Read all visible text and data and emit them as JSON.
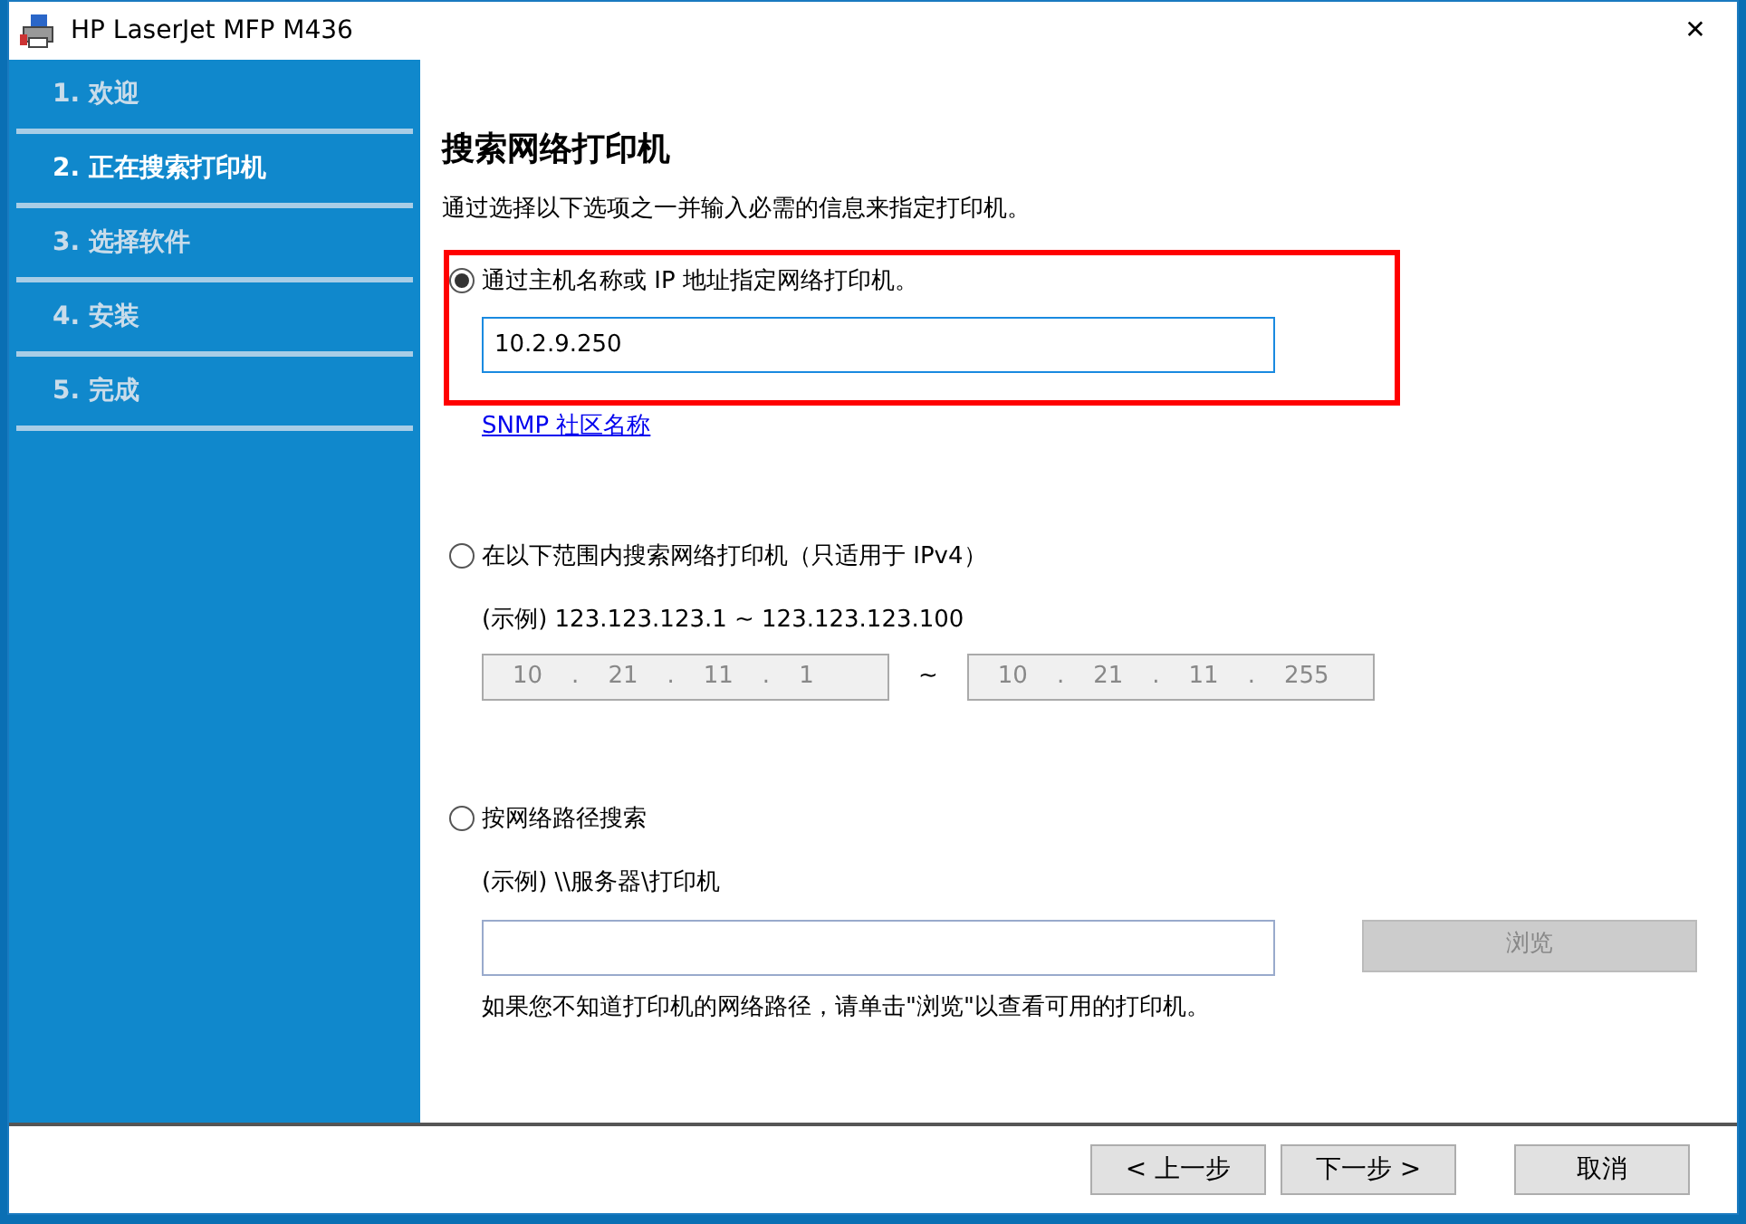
{
  "window": {
    "title": "HP LaserJet MFP M436",
    "close": "✕"
  },
  "sidebar": {
    "items": [
      {
        "label": "1. 欢迎",
        "selected": false
      },
      {
        "label": "2. 正在搜索打印机",
        "selected": true
      },
      {
        "label": "3. 选择软件",
        "selected": false
      },
      {
        "label": "4. 安装",
        "selected": false
      },
      {
        "label": "5. 完成",
        "selected": false
      }
    ]
  },
  "heading": "搜索网络打印机",
  "intro": "通过选择以下选项之一并输入必需的信息来指定打印机。",
  "options": [
    {
      "kind": "host",
      "label": "通过主机名称或 IP 地址指定网络打印机。",
      "selected": true,
      "highlighted": true,
      "value": "10.2.9.250",
      "link": "SNMP 社区名称"
    },
    {
      "kind": "range",
      "label": "在以下范围内搜索网络打印机（只适用于 IPv4）",
      "selected": false,
      "example": "(示例) 123.123.123.1 ~ 123.123.123.100",
      "from": [
        "10",
        "21",
        "11",
        "1"
      ],
      "to": [
        "10",
        "21",
        "11",
        "255"
      ],
      "separator": ".",
      "between": "~"
    },
    {
      "kind": "path",
      "label": "按网络路径搜索",
      "selected": false,
      "example": "(示例) \\\\服务器\\打印机",
      "button": "浏览",
      "button_disabled": true,
      "hint": "如果您不知道打印机的网络路径，请单击\"浏览\"以查看可用的打印机。"
    }
  ],
  "buttons": [
    {
      "label": "< 上一步"
    },
    {
      "label": "下一步 >"
    },
    {
      "label": "取消"
    }
  ]
}
